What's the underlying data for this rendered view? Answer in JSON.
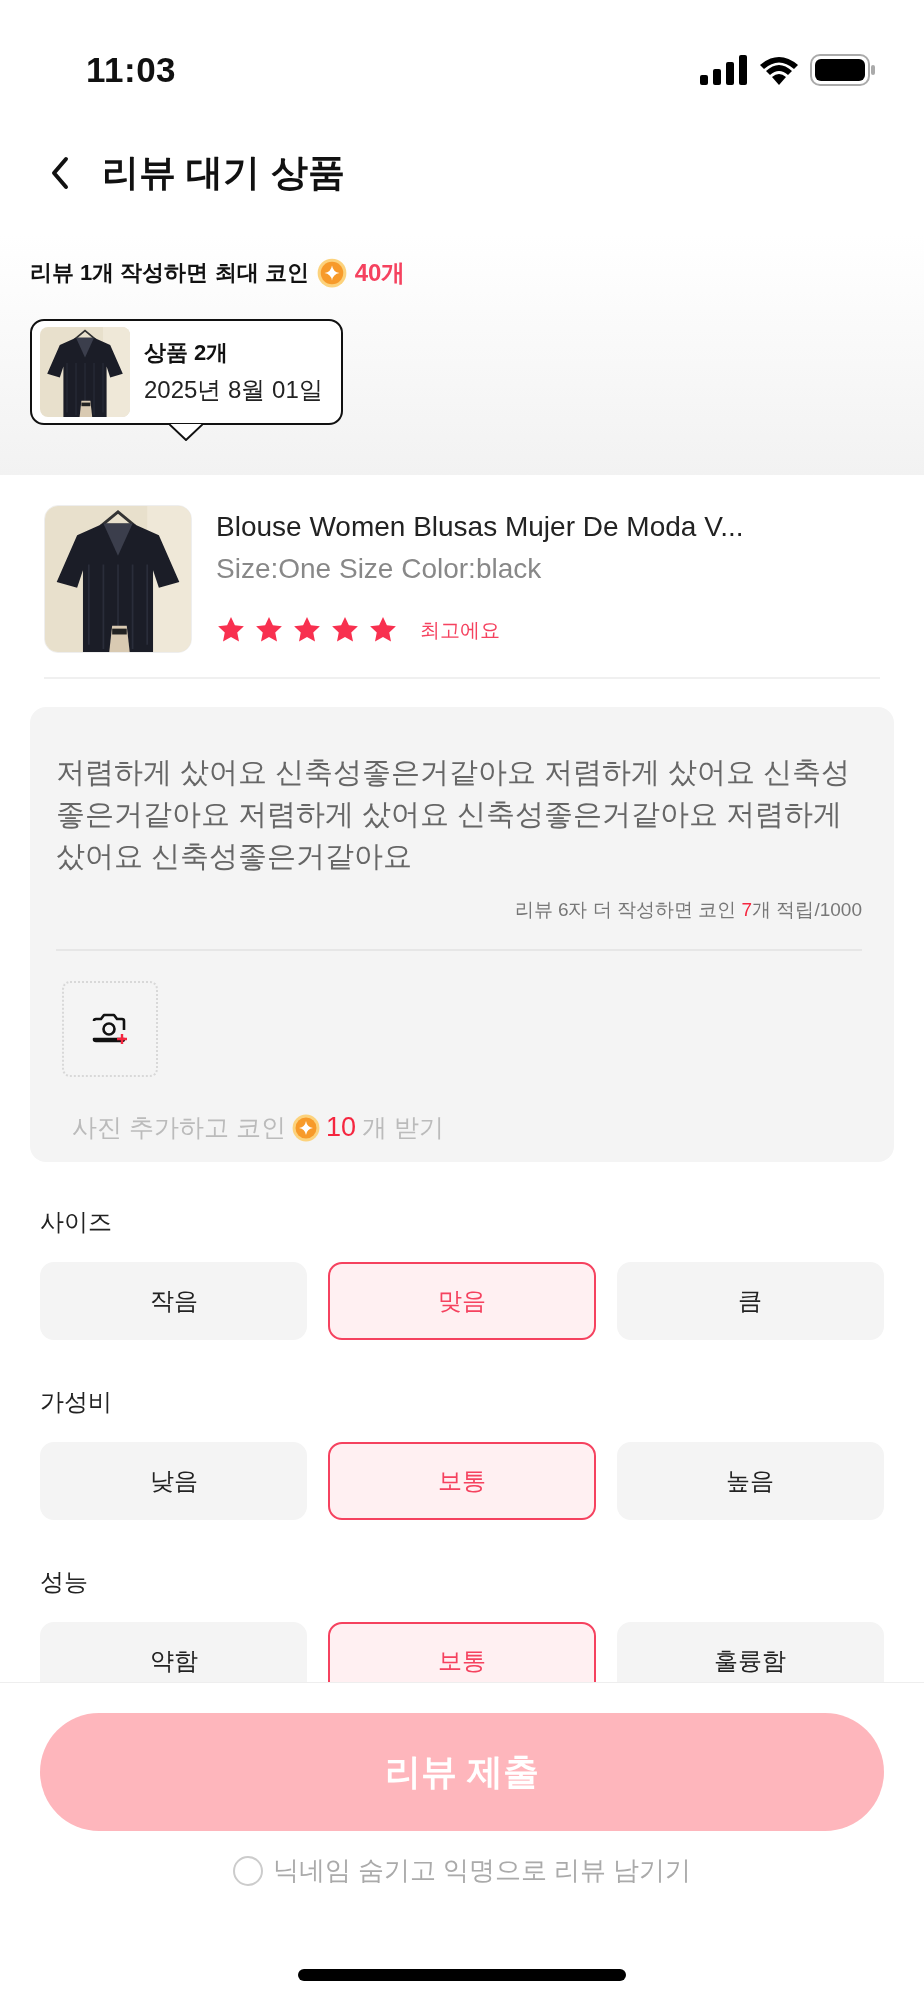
{
  "status_bar": {
    "time": "11:03"
  },
  "header": {
    "title": "리뷰 대기 상품"
  },
  "reward_banner": {
    "text": "리뷰 1개 작성하면 최대 코인",
    "amount": "40개"
  },
  "order_tooltip": {
    "count": "상품 2개",
    "date": "2025년 8월 01일"
  },
  "product": {
    "title": "Blouse Women Blusas Mujer De Moda V...",
    "variant": "Size:One Size Color:black",
    "stars": 5,
    "rating_label": "최고에요"
  },
  "review": {
    "value": "저렴하게 샀어요 신축성좋은거같아요 저렴하게 샀어요 신축성좋은거같아요 저렴하게 샀어요 신축성좋은거같아요 저렴하게 샀어요 신축성좋은거같아요",
    "counter_prefix": "리뷰 6자 더 작성하면 코인 ",
    "counter_highlight": "7",
    "counter_suffix": "개 적립/1000",
    "photo_hint": "사진 추가하고 코인",
    "photo_coins": "10",
    "photo_suffix": "개 받기"
  },
  "option_groups": [
    {
      "label": "사이즈",
      "options": [
        {
          "label": "작음",
          "selected": false
        },
        {
          "label": "맞음",
          "selected": true
        },
        {
          "label": "큼",
          "selected": false
        }
      ]
    },
    {
      "label": "가성비",
      "options": [
        {
          "label": "낮음",
          "selected": false
        },
        {
          "label": "보통",
          "selected": true
        },
        {
          "label": "높음",
          "selected": false
        }
      ]
    },
    {
      "label": "성능",
      "options": [
        {
          "label": "약함",
          "selected": false
        },
        {
          "label": "보통",
          "selected": true
        },
        {
          "label": "훌륭함",
          "selected": false
        }
      ]
    }
  ],
  "submit_button": {
    "label": "리뷰 제출",
    "disabled": true
  },
  "anonymous_option": {
    "label": "닉네임 숨기고 익명으로 리뷰 남기기",
    "checked": false
  }
}
